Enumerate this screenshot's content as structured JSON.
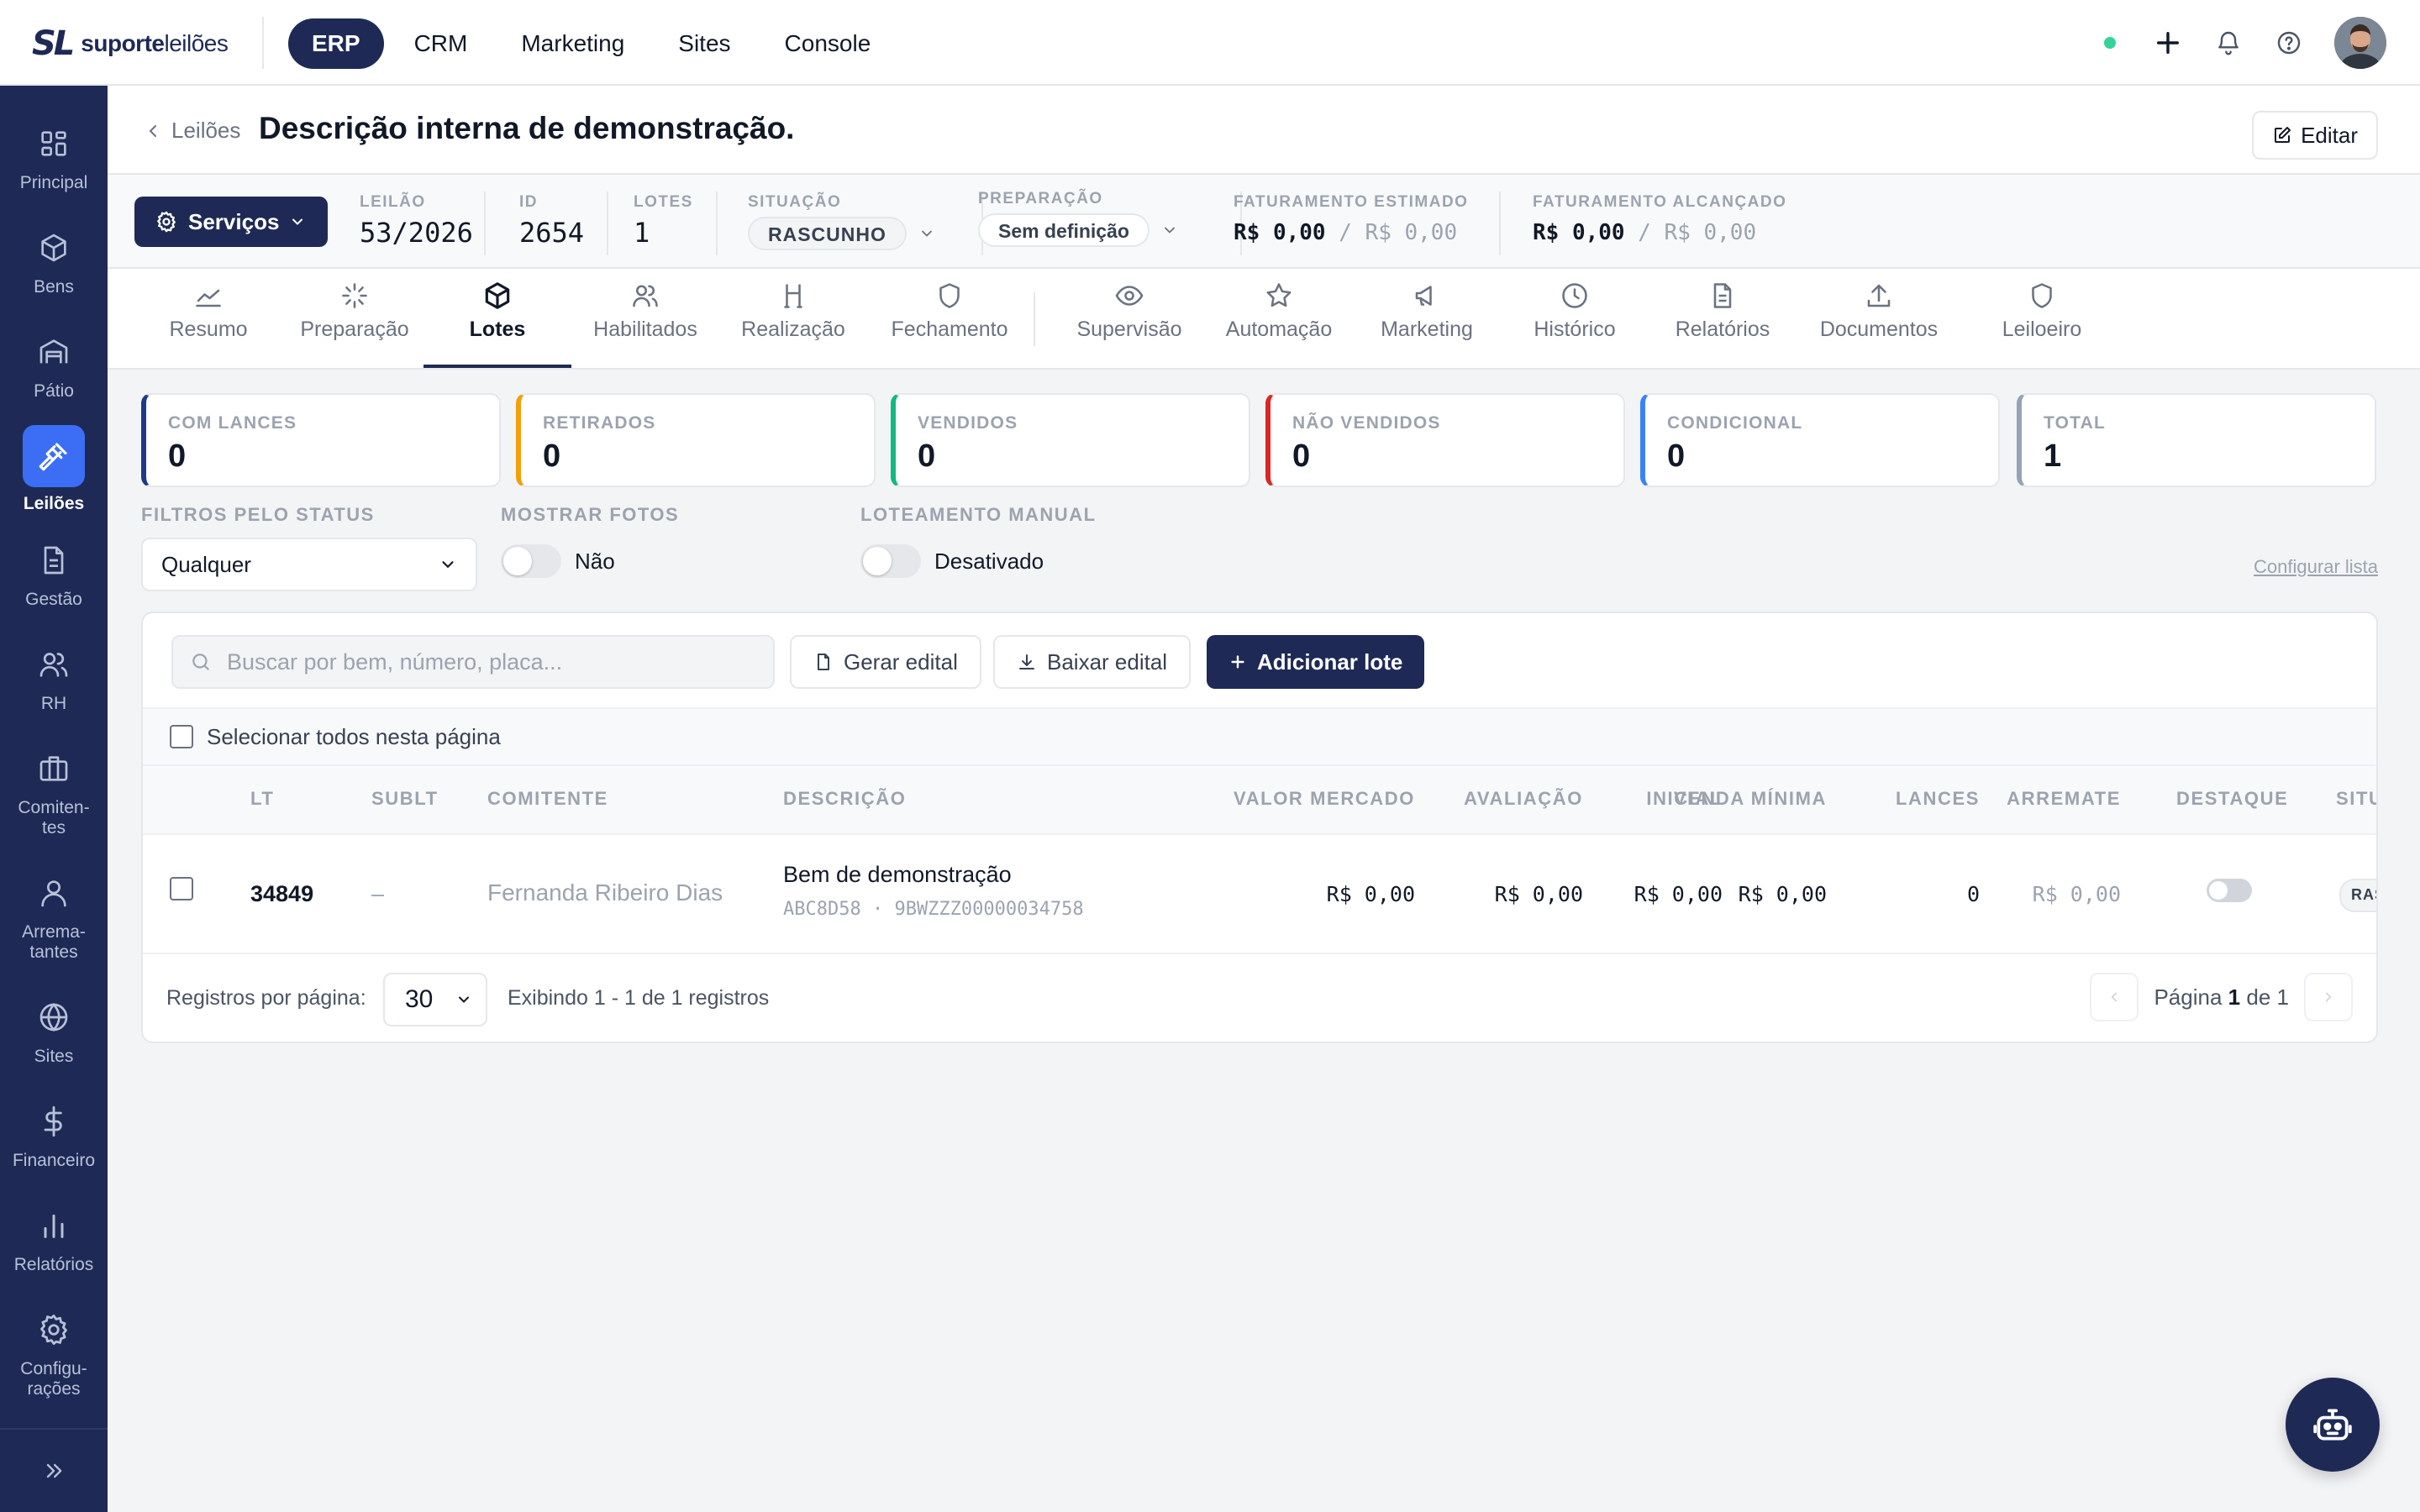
{
  "brand": {
    "mark": "SL",
    "name_bold": "suporte",
    "name_light": "leilões"
  },
  "topnav": [
    {
      "label": "ERP",
      "active": true
    },
    {
      "label": "CRM",
      "active": false
    },
    {
      "label": "Marketing",
      "active": false
    },
    {
      "label": "Sites",
      "active": false
    },
    {
      "label": "Console",
      "active": false
    }
  ],
  "topbar_icons": [
    "plus-icon",
    "bell-icon",
    "help-icon",
    "user-avatar"
  ],
  "sidebar": {
    "items": [
      {
        "label": "Principal",
        "icon": "grid-icon"
      },
      {
        "label": "Bens",
        "icon": "box-icon"
      },
      {
        "label": "Pátio",
        "icon": "warehouse-icon"
      },
      {
        "label": "Leilões",
        "icon": "gavel-icon",
        "active": true
      },
      {
        "label": "Gestão",
        "icon": "document-icon"
      },
      {
        "label": "RH",
        "icon": "users-icon"
      },
      {
        "label": "Comiten-\ntes",
        "icon": "briefcase-icon"
      },
      {
        "label": "Arrema-\ntantes",
        "icon": "user-icon"
      },
      {
        "label": "Sites",
        "icon": "globe-icon"
      },
      {
        "label": "Financeiro",
        "icon": "dollar-icon"
      },
      {
        "label": "Relatórios",
        "icon": "bar-chart-icon"
      },
      {
        "label": "Configu-\nrações",
        "icon": "gear-icon"
      }
    ]
  },
  "header": {
    "breadcrumb": "Leilões",
    "title": "Descrição interna de demonstração.",
    "edit_label": "Editar"
  },
  "infobar": {
    "services_label": "Serviços",
    "leilao_label": "LEILÃO",
    "leilao_value": "53/2026",
    "id_label": "ID",
    "id_value": "2654",
    "lotes_label": "LOTES",
    "lotes_value": "1",
    "situacao_label": "SITUAÇÃO",
    "situacao_value": "RASCUNHO",
    "preparacao_label": "PREPARAÇÃO",
    "preparacao_value": "Sem definição",
    "fat_est_label": "FATURAMENTO ESTIMADO",
    "fat_est_value": "R$ 0,00",
    "fat_est_secondary": "/ R$ 0,00",
    "fat_alc_label": "FATURAMENTO ALCANÇADO",
    "fat_alc_value": "R$ 0,00",
    "fat_alc_secondary": "/ R$ 0,00"
  },
  "tabs": [
    {
      "label": "Resumo",
      "icon": "trend-icon"
    },
    {
      "label": "Preparação",
      "icon": "loader-icon"
    },
    {
      "label": "Lotes",
      "icon": "cube-icon",
      "active": true
    },
    {
      "label": "Habilitados",
      "icon": "users-icon"
    },
    {
      "label": "Realização",
      "icon": "podium-icon"
    },
    {
      "label": "Fechamento",
      "icon": "shield-icon"
    },
    {
      "label": "Supervisão",
      "icon": "eye-icon"
    },
    {
      "label": "Automação",
      "icon": "star-icon"
    },
    {
      "label": "Marketing",
      "icon": "megaphone-icon"
    },
    {
      "label": "Histórico",
      "icon": "clock-icon"
    },
    {
      "label": "Relatórios",
      "icon": "file-icon"
    },
    {
      "label": "Documentos",
      "icon": "upload-icon"
    },
    {
      "label": "Leiloeiro",
      "icon": "shield-icon"
    }
  ],
  "stats": [
    {
      "label": "COM LANCES",
      "value": "0",
      "color": "#1e3a8a"
    },
    {
      "label": "RETIRADOS",
      "value": "0",
      "color": "#f59e0b"
    },
    {
      "label": "VENDIDOS",
      "value": "0",
      "color": "#10b981"
    },
    {
      "label": "NÃO VENDIDOS",
      "value": "0",
      "color": "#dc2626"
    },
    {
      "label": "CONDICIONAL",
      "value": "0",
      "color": "#3b82f6"
    },
    {
      "label": "TOTAL",
      "value": "1",
      "color": "#94a3b8"
    }
  ],
  "filters": {
    "status_label": "FILTROS PELO STATUS",
    "status_value": "Qualquer",
    "fotos_label": "MOSTRAR FOTOS",
    "fotos_value": "Não",
    "loteamento_label": "LOTEAMENTO MANUAL",
    "loteamento_value": "Desativado",
    "config_link": "Configurar lista"
  },
  "toolbar": {
    "search_placeholder": "Buscar por bem, número, placa...",
    "gerar_label": "Gerar edital",
    "baixar_label": "Baixar edital",
    "adicionar_label": "Adicionar lote",
    "select_all_label": "Selecionar todos nesta página"
  },
  "table": {
    "headers": [
      "LT",
      "SUBLT",
      "COMITENTE",
      "DESCRIÇÃO",
      "VALOR MERCADO",
      "AVALIAÇÃO",
      "INICIAL",
      "VENDA MÍNIMA",
      "LANCES",
      "ARREMATE",
      "DESTAQUE",
      "SITU"
    ],
    "rows": [
      {
        "lt": "34849",
        "sublt": "–",
        "comitente": "Fernanda Ribeiro Dias",
        "descricao": "Bem de demonstração",
        "descricao_sub": "ABC8D58 · 9BWZZZ00000034758",
        "valor_mercado": "R$ 0,00",
        "avaliacao": "R$ 0,00",
        "inicial": "R$ 0,00",
        "venda_minima": "R$ 0,00",
        "lances": "0",
        "arremate": "R$ 0,00",
        "destaque": false,
        "situacao": "RAS"
      }
    ]
  },
  "pagination": {
    "per_page_label": "Registros por página:",
    "per_page_value": "30",
    "info": "Exibindo 1 - 1 de 1 registros",
    "page_prefix": "Página",
    "page_current": "1",
    "page_sep": "de",
    "page_total": "1"
  }
}
